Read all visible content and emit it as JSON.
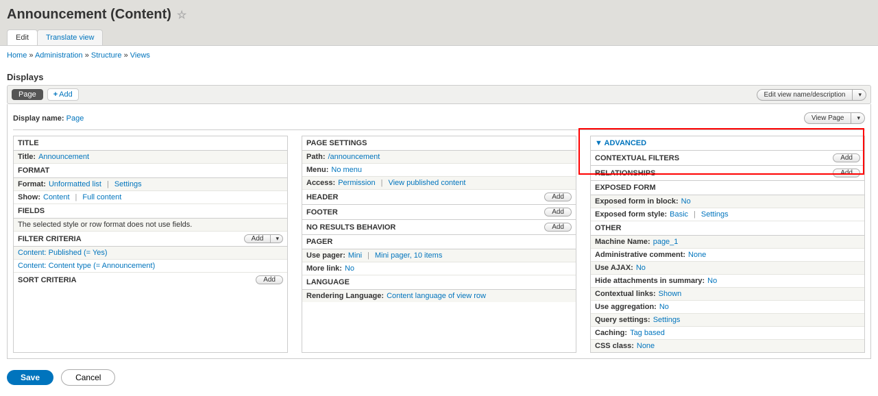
{
  "page_title": "Announcement (Content)",
  "tabs": {
    "edit": "Edit",
    "translate": "Translate view"
  },
  "breadcrumb": {
    "home": "Home",
    "admin": "Administration",
    "structure": "Structure",
    "views": "Views"
  },
  "displays": {
    "heading": "Displays",
    "page_tab": "Page",
    "add": "Add",
    "edit_view_name": "Edit view name/description"
  },
  "display_name": {
    "label": "Display name:",
    "value": "Page",
    "view_page": "View Page"
  },
  "col1": {
    "title_h": "TITLE",
    "title_label": "Title:",
    "title_value": "Announcement",
    "format_h": "FORMAT",
    "format_label": "Format:",
    "format_value": "Unformatted list",
    "settings": "Settings",
    "show_label": "Show:",
    "show_value": "Content",
    "full_content": "Full content",
    "fields_h": "FIELDS",
    "fields_note": "The selected style or row format does not use fields.",
    "filter_h": "FILTER CRITERIA",
    "add": "Add",
    "filter1": "Content: Published (= Yes)",
    "filter2": "Content: Content type (= Announcement)",
    "sort_h": "SORT CRITERIA"
  },
  "col2": {
    "page_settings_h": "PAGE SETTINGS",
    "path_label": "Path:",
    "path_value": "/announcement",
    "menu_label": "Menu:",
    "menu_value": "No menu",
    "access_label": "Access:",
    "access_value": "Permission",
    "access_detail": "View published content",
    "header_h": "HEADER",
    "footer_h": "FOOTER",
    "noresults_h": "NO RESULTS BEHAVIOR",
    "pager_h": "PAGER",
    "use_pager_label": "Use pager:",
    "use_pager_value": "Mini",
    "pager_detail": "Mini pager, 10 items",
    "more_link_label": "More link:",
    "more_link_value": "No",
    "language_h": "LANGUAGE",
    "rendering_label": "Rendering Language:",
    "rendering_value": "Content language of view row",
    "add": "Add"
  },
  "col3": {
    "advanced": "ADVANCED",
    "contextual_h": "CONTEXTUAL FILTERS",
    "relationships_h": "RELATIONSHIPS",
    "exposed_h": "EXPOSED FORM",
    "exposed_block_label": "Exposed form in block:",
    "exposed_block_value": "No",
    "exposed_style_label": "Exposed form style:",
    "exposed_style_value": "Basic",
    "settings": "Settings",
    "other_h": "OTHER",
    "machine_label": "Machine Name:",
    "machine_value": "page_1",
    "admin_comment_label": "Administrative comment:",
    "admin_comment_value": "None",
    "ajax_label": "Use AJAX:",
    "ajax_value": "No",
    "hide_label": "Hide attachments in summary:",
    "hide_value": "No",
    "contextual_links_label": "Contextual links:",
    "contextual_links_value": "Shown",
    "aggregation_label": "Use aggregation:",
    "aggregation_value": "No",
    "query_label": "Query settings:",
    "query_value": "Settings",
    "caching_label": "Caching:",
    "caching_value": "Tag based",
    "css_label": "CSS class:",
    "css_value": "None",
    "add": "Add"
  },
  "footer": {
    "save": "Save",
    "cancel": "Cancel"
  }
}
